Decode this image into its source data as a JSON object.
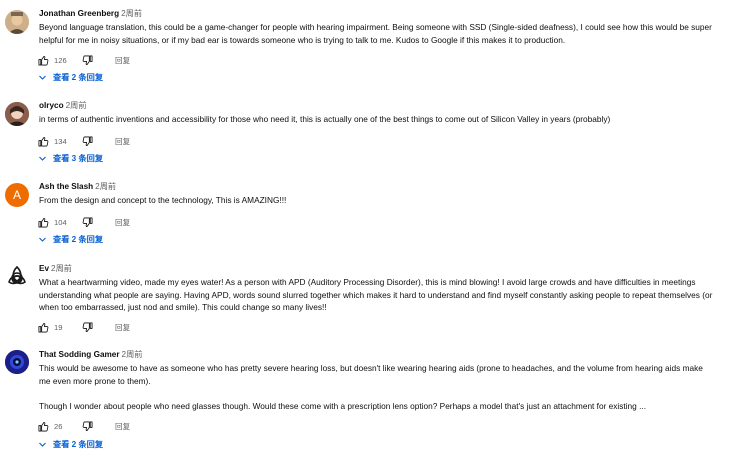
{
  "comments": [
    {
      "author": "Jonathan Greenberg",
      "time": "2周前",
      "paragraphs": [
        "Beyond language translation, this could be a game-changer for people with hearing impairment. Being someone with SSD (Single-sided deafness), I could see how this would be super helpful for me in noisy situations, or if my bad ear is towards someone who is trying to talk to me. Kudos to Google if this makes it to production."
      ],
      "likes": "126",
      "reply": "回复",
      "replies_label": "查看 2 条回复"
    },
    {
      "author": "olryco",
      "time": "2周前",
      "paragraphs": [
        "in terms of authentic inventions and accessibility for those who need it, this is actually one of the best things to come out of Silicon Valley in years (probably)"
      ],
      "likes": "134",
      "reply": "回复",
      "replies_label": "查看 3 条回复"
    },
    {
      "author": "Ash the Slash",
      "time": "2周前",
      "avatar_letter": "A",
      "paragraphs": [
        "From the design and concept to the technology, This is AMAZING!!!"
      ],
      "likes": "104",
      "reply": "回复",
      "replies_label": "查看 2 条回复"
    },
    {
      "author": "Ev",
      "time": "2周前",
      "paragraphs": [
        "What a heartwarming video, made my eyes water!  As a person with APD (Auditory Processing Disorder), this is mind blowing!  I avoid large crowds and have difficulties in meetings understanding what people are saying.  Having APD, words sound slurred together which makes it hard to understand and find myself constantly asking people to repeat themselves (or when too embarrassed, just nod and smile).  This could change so many lives!!"
      ],
      "likes": "19",
      "reply": "回复"
    },
    {
      "author": "That Sodding Gamer",
      "time": "2周前",
      "paragraphs": [
        "This would be awesome to have as someone who has pretty severe hearing loss, but doesn't like wearing hearing aids (prone to headaches, and the volume from hearing aids make me even more prone to them).",
        "Though I wonder about people who need glasses though.  Would these come with a prescription lens option?  Perhaps a model that's just an attachment for existing ..."
      ],
      "likes": "26",
      "reply": "回复",
      "replies_label": "查看 2 条回复"
    }
  ],
  "colors": {
    "text": "#0f0f0f",
    "secondary": "#606060",
    "link": "#065fd4",
    "avatar_ash": "#ef6c00"
  },
  "icons": {
    "like": "thumb-up-icon",
    "dislike": "thumb-down-icon",
    "replies": "chevron-down-icon"
  }
}
